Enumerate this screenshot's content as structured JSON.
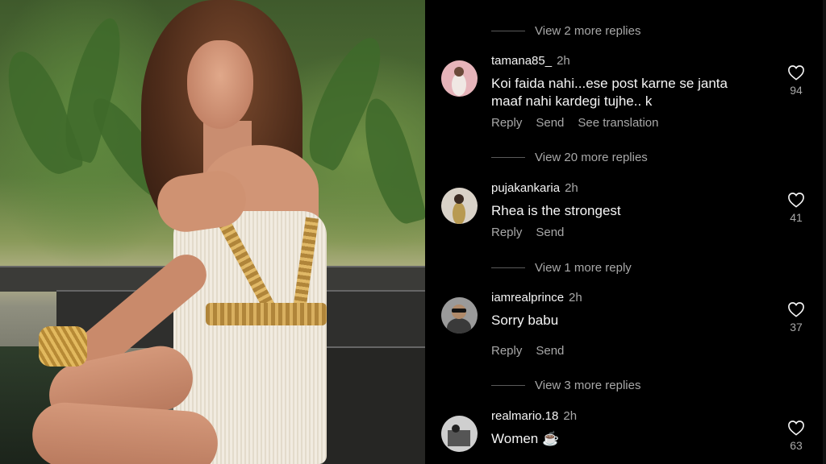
{
  "image": {
    "description": ""
  },
  "replies_toggles": [
    {
      "label": "View 2 more replies"
    },
    {
      "label": "View 20 more replies"
    },
    {
      "label": "View 1 more reply"
    },
    {
      "label": "View 3 more replies"
    }
  ],
  "comments": [
    {
      "username": "tamana85_",
      "time": "2h",
      "text": "Koi faida nahi...ese post karne se janta maaf nahi kardegi tujhe.. k",
      "likes": "94",
      "actions": {
        "reply": "Reply",
        "send": "Send",
        "translate": "See translation"
      }
    },
    {
      "username": "pujakankaria",
      "time": "2h",
      "text": "Rhea is the strongest",
      "likes": "41",
      "actions": {
        "reply": "Reply",
        "send": "Send"
      }
    },
    {
      "username": "iamrealprince",
      "time": "2h",
      "text": "Sorry babu",
      "likes": "37",
      "actions": {
        "reply": "Reply",
        "send": "Send"
      }
    },
    {
      "username": "realmario.18",
      "time": "2h",
      "text": "Women ☕",
      "likes": "63"
    }
  ],
  "colors": {
    "background": "#000000",
    "text": "#f5f5f5",
    "muted": "#a8a8a8"
  },
  "icons": {
    "like": "heart-outline-icon"
  }
}
